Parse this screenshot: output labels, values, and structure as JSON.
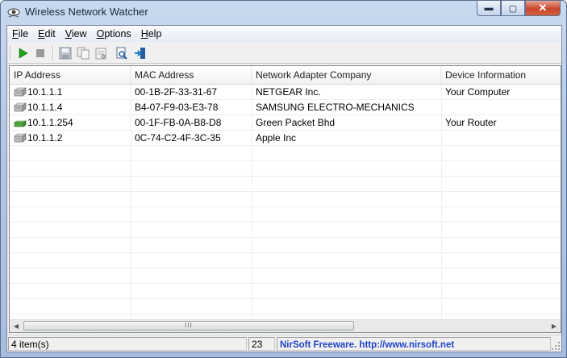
{
  "window": {
    "title": "Wireless Network Watcher",
    "minimize": "▬",
    "maximize": "▢",
    "close": "✕"
  },
  "menu": [
    {
      "first": "F",
      "rest": "ile"
    },
    {
      "first": "E",
      "rest": "dit"
    },
    {
      "first": "V",
      "rest": "iew"
    },
    {
      "first": "O",
      "rest": "ptions"
    },
    {
      "first": "H",
      "rest": "elp"
    }
  ],
  "toolbar": {
    "icons": [
      "play-icon",
      "stop-icon",
      "save-icon",
      "copy-icon",
      "properties-icon",
      "find-icon",
      "exit-icon"
    ],
    "colors": {
      "play": "#1fa31f",
      "stop": "#9a9a9a",
      "exit": "#1d7fd4"
    }
  },
  "table": {
    "columns": [
      "IP Address",
      "MAC Address",
      "Network Adapter Company",
      "Device Information"
    ],
    "rows": [
      {
        "icon": "computer-icon",
        "ip": "10.1.1.1",
        "mac": "00-1B-2F-33-31-67",
        "company": "NETGEAR Inc.",
        "info": "Your Computer"
      },
      {
        "icon": "computer-icon",
        "ip": "10.1.1.4",
        "mac": "B4-07-F9-03-E3-78",
        "company": "SAMSUNG ELECTRO-MECHANICS",
        "info": ""
      },
      {
        "icon": "router-icon",
        "ip": "10.1.1.254",
        "mac": "00-1F-FB-0A-B8-D8",
        "company": "Green Packet Bhd",
        "info": "Your Router"
      },
      {
        "icon": "computer-icon",
        "ip": "10.1.1.2",
        "mac": "0C-74-C2-4F-3C-35",
        "company": "Apple Inc",
        "info": ""
      }
    ]
  },
  "status": {
    "items": "4 item(s)",
    "number": "23",
    "link": "NirSoft Freeware.  http://www.nirsoft.net"
  },
  "scrollbar": {
    "thumb_grip": "III"
  }
}
